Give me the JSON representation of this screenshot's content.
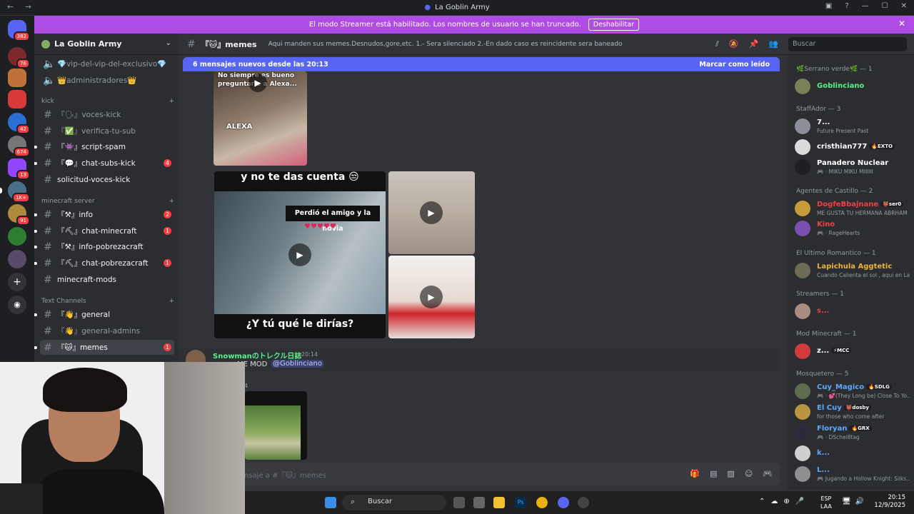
{
  "window": {
    "title": "La Goblin Army",
    "controls": [
      "—",
      "☐",
      "✕"
    ]
  },
  "banner": {
    "text": "El modo Streamer está habilitado. Los nombres de usuario se han truncado.",
    "button": "Deshabilitar"
  },
  "guild_badges": [
    "382",
    "76",
    "",
    "",
    "42",
    "674",
    "13",
    "1K+",
    "91",
    "",
    ""
  ],
  "server": {
    "name": "La Goblin Army"
  },
  "channels_top": [
    {
      "label": "💎vip-del-vip-del-exclusivo💎"
    },
    {
      "label": "👑administradores👑"
    }
  ],
  "categories": {
    "kick": "kick",
    "minecraft": "minecraft server",
    "text": "Text Channels"
  },
  "kick_channels": [
    {
      "label": "『🗣』voces-kick",
      "count": ""
    },
    {
      "label": "『✅』verifica-tu-sub",
      "count": ""
    },
    {
      "label": "『👾』script-spam",
      "count": ""
    },
    {
      "label": "『💬』chat-subs-kick",
      "count": "4"
    },
    {
      "label": "solicitud-voces-kick",
      "count": ""
    }
  ],
  "mc_channels": [
    {
      "label": "『⚒』info",
      "count": "2"
    },
    {
      "label": "『⛏』chat-minecraft",
      "count": "1"
    },
    {
      "label": "『⚒』info-pobrezacraft",
      "count": ""
    },
    {
      "label": "『⛏』chat-pobrezacraft",
      "count": "1"
    },
    {
      "label": "minecraft-mods",
      "count": ""
    }
  ],
  "text_channels": [
    {
      "label": "『👋』general",
      "count": ""
    },
    {
      "label": "『👋』general-admins",
      "count": ""
    },
    {
      "label": "『🐱』memes",
      "count": "1"
    }
  ],
  "topbar": {
    "channel": "『🐱』memes",
    "topic": "Aqui manden sus memes.Desnudos,gore,etc. 1.- Sera silenciado 2.-En dado caso es reincidente sera baneado",
    "search_placeholder": "Buscar"
  },
  "new_messages": {
    "text": "6 mensajes nuevos desde las 20:13",
    "action": "Marcar como leído"
  },
  "media_captions": {
    "top1": "No siempre es bueno preguntarle a Alexa...",
    "top1_label": "ALEXA",
    "big_top": "y no te das cuenta 😒",
    "big_mid": "Perdió el amigo y la novia",
    "big_bottom": "¿Y tú qué le dirías?"
  },
  "message": {
    "author": "Snowmanのトレクル日誌",
    "time": "20:14",
    "text": "ME MOD",
    "mention": "@Goblinciano",
    "time2": "4"
  },
  "composer": {
    "placeholder": "nsaje a #『🐱』memes"
  },
  "members": {
    "categories": [
      {
        "label": "🌿Serrano verde🌿 — 1"
      },
      {
        "label": "StaffAdor — 3"
      },
      {
        "label": "Agentes de Castillo — 2"
      },
      {
        "label": "El Ultimo Romantico — 1"
      },
      {
        "label": "Streamers — 1"
      },
      {
        "label": "Mod Minecraft — 1"
      },
      {
        "label": "Mosquetero — 5"
      }
    ],
    "list": [
      {
        "name": "Goblinciano",
        "status": "",
        "tag": "",
        "color": "#57f287"
      },
      {
        "name": "7...",
        "status": "Future Present Past",
        "tag": "",
        "color": "#ffffff"
      },
      {
        "name": "cristhian777",
        "status": "",
        "tag": "🔥EXTO",
        "color": "#ffffff"
      },
      {
        "name": "Panadero Nuclear",
        "status": "🎮 · MIKU MIKU MIIIIII",
        "tag": "",
        "color": "#ffffff"
      },
      {
        "name": "DogfeBbajnane",
        "status": "ME GUSTA TU HERMANA ABRHAM",
        "tag": "👹ser0",
        "color": "#ed4245"
      },
      {
        "name": "Kino",
        "status": "🎮 · RageHearts",
        "tag": "",
        "color": "#ed4245"
      },
      {
        "name": "Lapichula Aggtetic",
        "status": "Cuando Calienta el sol , aqui en La...",
        "tag": "",
        "color": "#f0b232"
      },
      {
        "name": "s...",
        "status": "",
        "tag": "",
        "color": "#ed4245"
      },
      {
        "name": "z...",
        "status": "",
        "tag": "⚡MCC",
        "color": "#ffffff"
      },
      {
        "name": "Cuy_Magico",
        "status": "🎮 · 💕(They Long be) Close To Yo...",
        "tag": "🔥SDLG",
        "color": "#5fa8ff"
      },
      {
        "name": "El Cuy",
        "status": "for those who come after",
        "tag": "👹dosby",
        "color": "#5fa8ff"
      },
      {
        "name": "Floryan",
        "status": "🎮 · DSchei8tag",
        "tag": "🔥GRX",
        "color": "#5fa8ff"
      },
      {
        "name": "k...",
        "status": "",
        "tag": "",
        "color": "#5fa8ff"
      },
      {
        "name": "L...",
        "status": "🎮 Jugando a Hollow Knight: Silks...",
        "tag": "",
        "color": "#5fa8ff"
      }
    ]
  },
  "taskbar": {
    "search": "Buscar",
    "lang1": "ESP",
    "lang2": "LAA",
    "time": "20:15",
    "date": "12/9/2025"
  }
}
